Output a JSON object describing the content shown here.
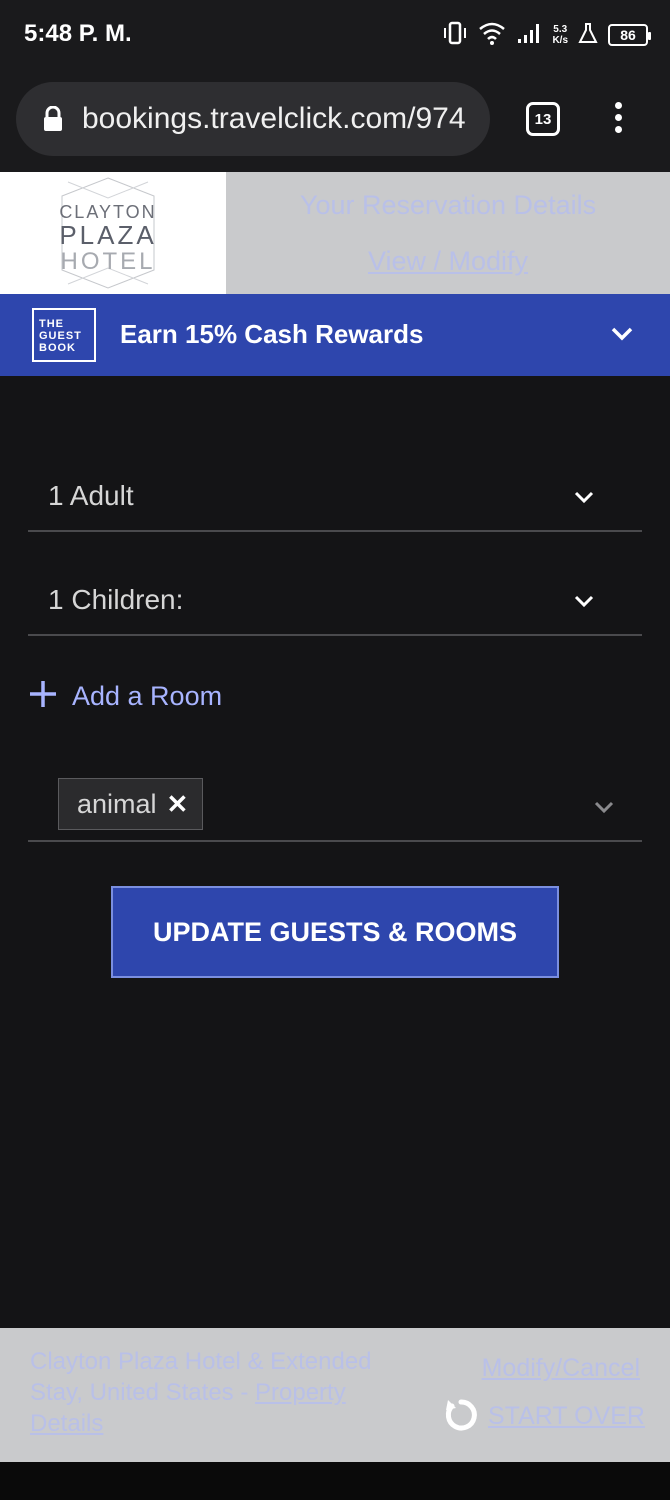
{
  "status_bar": {
    "time": "5:48 P. M.",
    "speed_value": "5.3",
    "speed_unit": "K/s",
    "battery": "86",
    "icons": [
      "vibrate-icon",
      "wifi-icon",
      "signal-icon",
      "flask-icon",
      "battery-icon"
    ]
  },
  "browser": {
    "url": "bookings.travelclick.com/974",
    "tab_count": "13"
  },
  "header": {
    "logo_line1": "CLAYTON",
    "logo_line2": "PLAZA",
    "logo_line3": "HOTEL",
    "reservation_details": "Your Reservation Details",
    "view_modify": "View / Modify"
  },
  "rewards": {
    "logo_line1": "THE",
    "logo_line2": "GUEST",
    "logo_line3": "BOOK",
    "label": "Earn 15% Cash Rewards"
  },
  "form": {
    "adults": "1 Adult",
    "children": "1 Children:",
    "add_room": "Add a Room",
    "tag": "animal",
    "tag_remove": "✕",
    "update_button": "UPDATE GUESTS & ROOMS"
  },
  "footer": {
    "hotel_text": "Clayton Plaza Hotel & Extended Stay, United States - ",
    "property_details": "Property Details",
    "modify_cancel": "Modify/Cancel",
    "start_over": "START OVER"
  },
  "colors": {
    "brand_blue": "#2e46ad",
    "background": "#141416",
    "link_faint": "#b9c0e8",
    "accent_link": "#a8b4ff"
  }
}
